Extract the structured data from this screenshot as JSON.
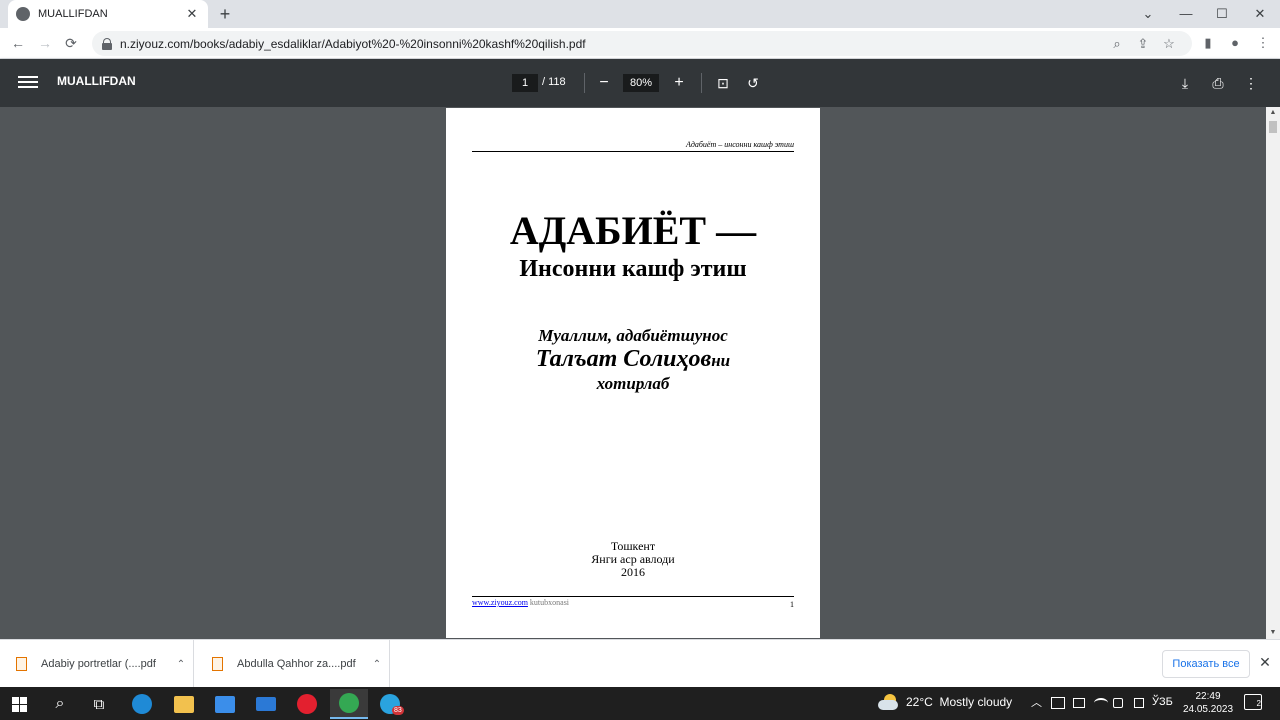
{
  "browser": {
    "tab": {
      "title": "MUALLIFDAN",
      "close": "✕"
    },
    "new_tab": "+",
    "window": {
      "minimize": "⌄",
      "restore": "—",
      "maximize": "☐",
      "close": "✕"
    },
    "nav": {
      "back": "←",
      "forward": "→",
      "reload": "⟳"
    },
    "address": {
      "url": "n.ziyouz.com/books/adabiy_esdaliklar/Adabiyot%20-%20insonni%20kashf%20qilish.pdf"
    },
    "omni_icons": {
      "zoom": "⌕",
      "share": "⇪",
      "bookmark": "☆"
    },
    "tool_icons": {
      "sidepanel": "▮",
      "profile": "●",
      "menu": "⋮"
    }
  },
  "pdf_toolbar": {
    "title": "MUALLIFDAN",
    "page_current": "1",
    "page_total": "/ 118",
    "zoom_out": "−",
    "zoom_value": "80%",
    "zoom_in": "+",
    "fit_icon": "⊡",
    "rotate_icon": "↺",
    "download_icon": "⤓",
    "print_icon": "⎙",
    "more_icon": "⋮"
  },
  "pdf_page": {
    "running_header": "Адабиёт – инсонни кашф этиш",
    "title": "АДАБИЁТ —",
    "subtitle": "Инсонни кашф этиш",
    "author_line1": "Муаллим, адабиётшунос",
    "author_name": "Талъат Солиҳов",
    "author_name_suffix": "ни",
    "author_line3": "хотирлаб",
    "city": "Тошкент",
    "publisher": "Янги аср авлоди",
    "year": "2016",
    "footer_link": "www.ziyouz.com",
    "footer_library": "kutubxonasi",
    "page_number": "1"
  },
  "scrollbar": {
    "up": "▲",
    "down": "▼"
  },
  "downloads": {
    "items": [
      {
        "name": "Adabiy portretlar (....pdf",
        "chevron": "⌃"
      },
      {
        "name": "Abdulla Qahhor za....pdf",
        "chevron": "⌃"
      }
    ],
    "show_all": "Показать все",
    "close": "✕"
  },
  "taskbar": {
    "search_icon": "⌕",
    "taskview_icon": "⧉",
    "telegram_badge": "83",
    "weather": {
      "temp": "22°C",
      "desc": "Mostly cloudy"
    },
    "tray": {
      "chevron": "︿",
      "lang": "ЎЗБ"
    },
    "time": "22:49",
    "date": "24.05.2023",
    "notifications": "2",
    "colors": {
      "edge": "#1f8ad6",
      "explorer": "#f2c14e",
      "store": "#3b8eea",
      "mail": "#2b79d6",
      "opera": "#e3202f",
      "chrome": "#34a853",
      "telegram": "#2aa3df"
    }
  }
}
